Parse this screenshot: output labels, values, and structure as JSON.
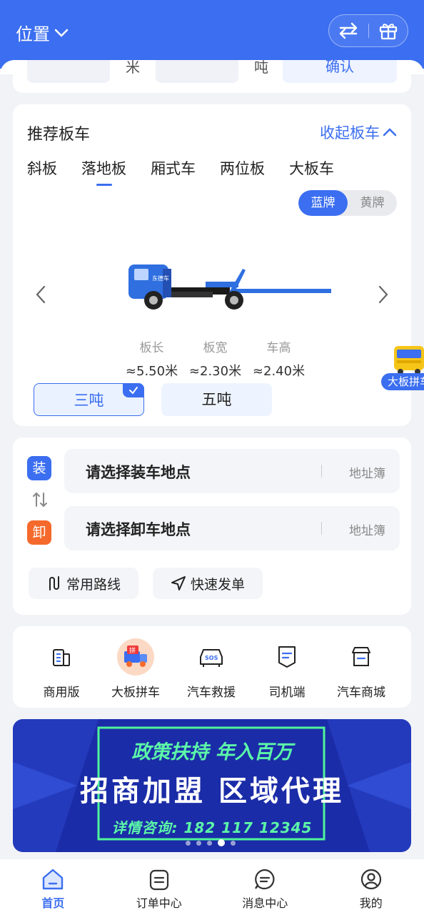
{
  "header": {
    "location_label": "位置"
  },
  "top_form": {
    "length_unit": "米",
    "weight_unit": "吨",
    "confirm_label": "确认"
  },
  "truck_card": {
    "title": "推荐板车",
    "collapse_label": "收起板车",
    "tabs": [
      {
        "label": "斜板"
      },
      {
        "label": "落地板"
      },
      {
        "label": "厢式车"
      },
      {
        "label": "两位板"
      },
      {
        "label": "大板车"
      }
    ],
    "active_tab": "落地板",
    "plates": [
      {
        "label": "蓝牌"
      },
      {
        "label": "黄牌"
      }
    ],
    "active_plate": "蓝牌",
    "truck_door_text": "东德车",
    "fab_label": "大板拼车",
    "specs": [
      {
        "label": "板长",
        "value": "≈5.50米"
      },
      {
        "label": "板宽",
        "value": "≈2.30米"
      },
      {
        "label": "车高",
        "value": "≈2.40米"
      }
    ],
    "tons": [
      {
        "label": "三吨"
      },
      {
        "label": "五吨"
      }
    ],
    "selected_ton": "三吨"
  },
  "route_card": {
    "load_tag": "装",
    "unload_tag": "卸",
    "load_placeholder": "请选择装车地点",
    "unload_placeholder": "请选择卸车地点",
    "address_book": "地址簿",
    "common_routes": "常用路线",
    "quick_order": "快速发单"
  },
  "services": [
    {
      "label": "商用版",
      "icon": "building-icon"
    },
    {
      "label": "大板拼车",
      "icon": "carpool-truck-icon",
      "badge": "拼"
    },
    {
      "label": "汽车救援",
      "icon": "sos-car-icon",
      "badge": "SOS"
    },
    {
      "label": "司机端",
      "icon": "driver-doc-icon"
    },
    {
      "label": "汽车商城",
      "icon": "shop-icon"
    }
  ],
  "banner": {
    "line1": "政策扶持 年入百万",
    "line2": "招商加盟 区域代理",
    "line3": "详情咨询: 182 117 12345",
    "slides": 5,
    "active_slide": 4
  },
  "tabbar": [
    {
      "label": "首页",
      "icon": "home-icon",
      "active": true
    },
    {
      "label": "订单中心",
      "icon": "order-icon",
      "active": false
    },
    {
      "label": "消息中心",
      "icon": "message-icon",
      "active": false
    },
    {
      "label": "我的",
      "icon": "profile-icon",
      "active": false
    }
  ],
  "colors": {
    "primary": "#3b6ef0",
    "accent_orange": "#f56a2c",
    "banner_green": "#5cf7a8",
    "banner_bg": "#1b2ca8"
  }
}
